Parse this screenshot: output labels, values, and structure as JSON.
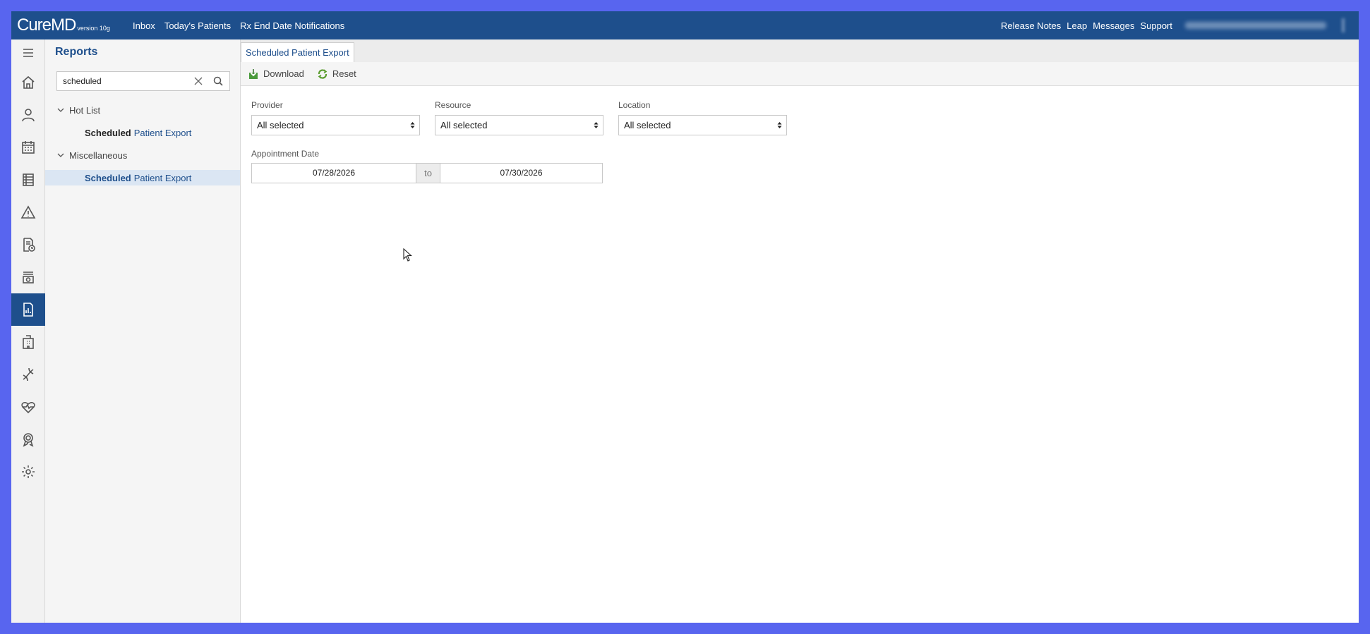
{
  "header": {
    "brand_name": "CureMD",
    "brand_version": "version 10g",
    "nav": [
      "Inbox",
      "Today's Patients",
      "Rx End Date Notifications"
    ],
    "right_links": [
      "Release Notes",
      "Leap",
      "Messages",
      "Support"
    ]
  },
  "rail": {
    "icons": [
      "home-icon",
      "user-icon",
      "calendar-icon",
      "ledger-icon",
      "alert-icon",
      "document-clock-icon",
      "billing-icon",
      "reports-icon",
      "building-icon",
      "dna-icon",
      "heart-rate-icon",
      "award-icon",
      "gear-icon"
    ],
    "active": "reports-icon"
  },
  "panel": {
    "title": "Reports",
    "search": {
      "value": "scheduled",
      "placeholder": ""
    },
    "groups": [
      {
        "label": "Hot List",
        "items": [
          {
            "bold": "Scheduled",
            "rest": "Patient Export"
          }
        ]
      },
      {
        "label": "Miscellaneous",
        "items": [
          {
            "bold": "Scheduled",
            "rest": "Patient Export",
            "selected": true
          }
        ]
      }
    ]
  },
  "main": {
    "tab_label": "Scheduled Patient Export",
    "toolbar": {
      "download_label": "Download",
      "reset_label": "Reset"
    },
    "filters": {
      "provider": {
        "label": "Provider",
        "value": "All selected"
      },
      "resource": {
        "label": "Resource",
        "value": "All selected"
      },
      "location": {
        "label": "Location",
        "value": "All selected"
      }
    },
    "appointment_date": {
      "label": "Appointment Date",
      "from": "07/28/2026",
      "sep": "to",
      "to": "07/30/2026"
    }
  },
  "colors": {
    "brand_blue": "#1e4f8c",
    "frame": "#5865ef",
    "selected_row": "#dbe6f3"
  }
}
